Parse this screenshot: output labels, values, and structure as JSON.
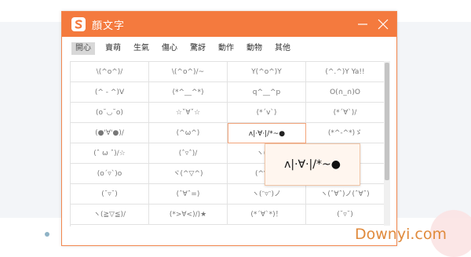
{
  "window": {
    "title": "顏文字",
    "accent_color": "#f47a3e",
    "controls": [
      "minimize-icon",
      "close-icon"
    ]
  },
  "tabs": [
    {
      "label": "開心",
      "active": true
    },
    {
      "label": "賣萌",
      "active": false
    },
    {
      "label": "生氣",
      "active": false
    },
    {
      "label": "傷心",
      "active": false
    },
    {
      "label": "驚訝",
      "active": false
    },
    {
      "label": "動作",
      "active": false
    },
    {
      "label": "動物",
      "active": false
    },
    {
      "label": "其他",
      "active": false
    }
  ],
  "emoticon_grid": [
    [
      "\\(^o^)/",
      "\\(^o^)/~",
      "Y(^o^)Y",
      "(^.^)Y Ya!!"
    ],
    [
      "(^ - ^)V",
      "(*^__^*)",
      "q^__^p",
      "O(∩_∩)O"
    ],
    [
      "(o˘◡˘o)",
      "☆ˇ∀ˇ☆",
      "(*´v`)",
      "(*´∀`)/"
    ],
    [
      "(●'∀'●)/",
      "(^ω^)",
      "ʌ|·∀·|/*~●",
      "(*^-^*)ゞ"
    ],
    [
      "(ˆ ω ˆ)/☆",
      "(ˆ▿ˆ)/",
      "ヽ(^o",
      "ˆ)"
    ],
    [
      "(o´▿`)o",
      "ヾ(^▽^)",
      "(^▽^)",
      "ˆ)/"
    ],
    [
      "(˘▿˘)",
      "(ˆ∀ˆ=)",
      "ヽ(ᵔ▿ᵔ)ノ",
      "ヽ(ˆ∀ˆ)ノ(ˆ∀ˆ)"
    ],
    [
      "ヽ(≧▽≦)/",
      "(*>∀<)/)★",
      "(*´∀`*)！",
      "(˘▿˘)"
    ]
  ],
  "hover_tooltip": {
    "text": "ʌ|·∀·|/*~●"
  },
  "watermark": "Downyi.com"
}
